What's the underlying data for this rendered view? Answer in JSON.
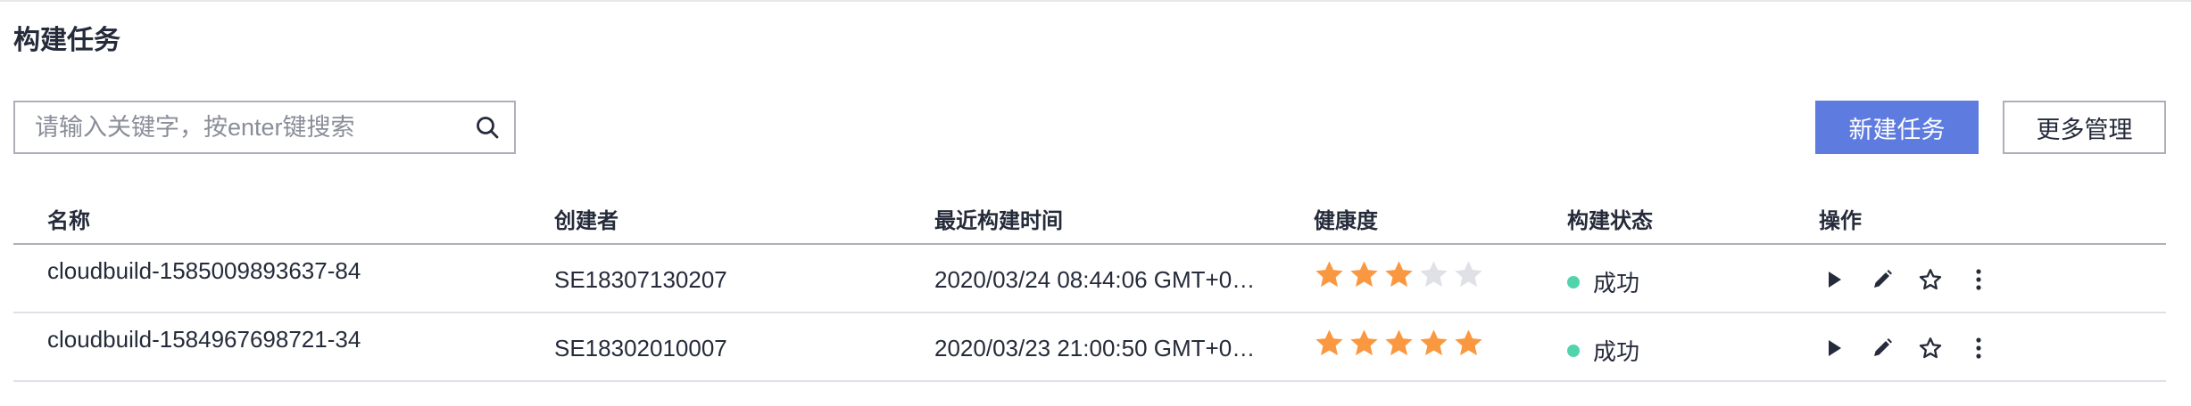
{
  "header": {
    "title": "构建任务"
  },
  "search": {
    "placeholder": "请输入关键字，按enter键搜索",
    "value": ""
  },
  "toolbar": {
    "new_task_label": "新建任务",
    "more_manage_label": "更多管理"
  },
  "table": {
    "columns": [
      "名称",
      "创建者",
      "最近构建时间",
      "健康度",
      "构建状态",
      "操作"
    ],
    "rows": [
      {
        "name": "cloudbuild-1585009893637-84",
        "creator": "SE18307130207",
        "last_build_time": "2020/03/24 08:44:06 GMT+0…",
        "health_stars": 3,
        "health_max": 5,
        "status": "成功"
      },
      {
        "name": "cloudbuild-1584967698721-34",
        "creator": "SE18302010007",
        "last_build_time": "2020/03/23 21:00:50 GMT+0…",
        "health_stars": 5,
        "health_max": 5,
        "status": "成功"
      }
    ]
  },
  "colors": {
    "primary": "#5e7ce0",
    "star_on": "#fa9841",
    "star_off": "#dfe1e6",
    "success": "#50d4ab",
    "text": "#252b3a"
  },
  "icons": {
    "search": "search-icon",
    "run": "play-icon",
    "edit": "edit-icon",
    "favorite": "star-outline-icon",
    "more": "more-vertical-icon"
  }
}
